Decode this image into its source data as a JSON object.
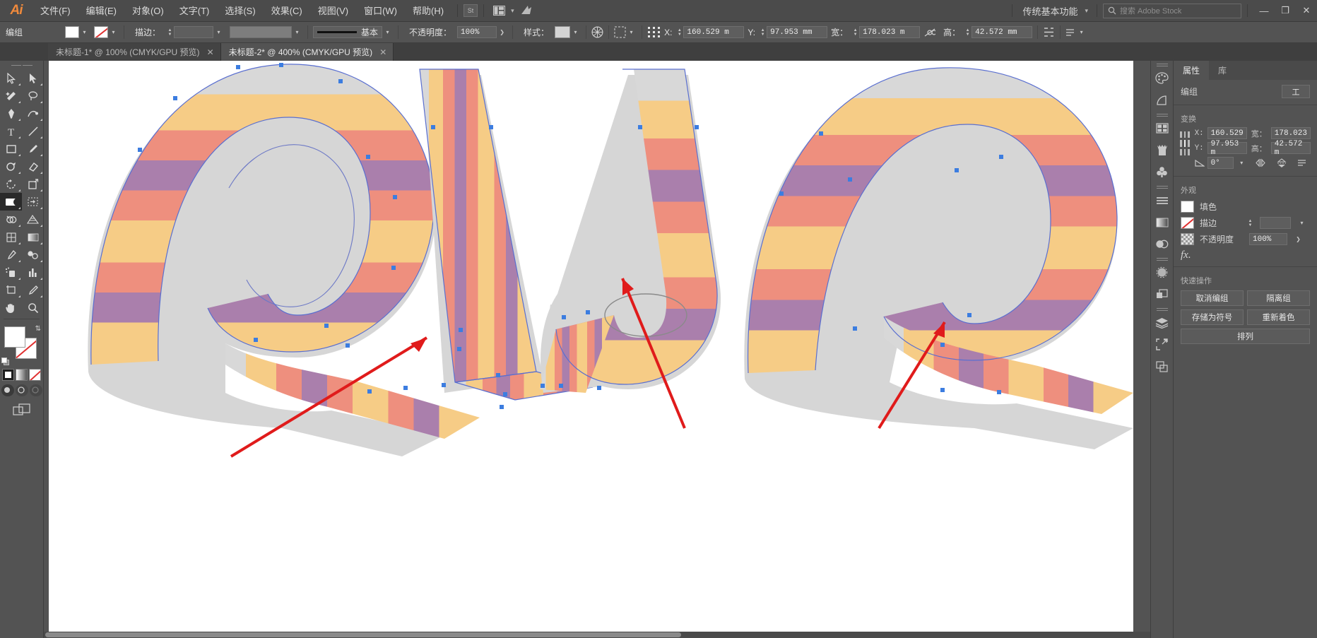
{
  "app": {
    "name": "Adobe Illustrator",
    "logo": "Ai"
  },
  "menubar": {
    "items": [
      {
        "label": "文件(F)",
        "name": "menu-file"
      },
      {
        "label": "编辑(E)",
        "name": "menu-edit"
      },
      {
        "label": "对象(O)",
        "name": "menu-object"
      },
      {
        "label": "文字(T)",
        "name": "menu-type"
      },
      {
        "label": "选择(S)",
        "name": "menu-select"
      },
      {
        "label": "效果(C)",
        "name": "menu-effect"
      },
      {
        "label": "视图(V)",
        "name": "menu-view"
      },
      {
        "label": "窗口(W)",
        "name": "menu-window"
      },
      {
        "label": "帮助(H)",
        "name": "menu-help"
      }
    ],
    "bridge_label": "St",
    "arrange_icon": "arrange-documents-icon",
    "stock_icon": "adobe-stock-icon",
    "workspace": "传统基本功能",
    "search_placeholder": "搜索 Adobe Stock",
    "minimize": "—",
    "restore": "❐",
    "close": "✕"
  },
  "controlbar": {
    "selection_label": "编组",
    "fill_label_icon": "fill-swatch",
    "stroke_label_icon": "stroke-swatch-none",
    "stroke_text": "描边：",
    "stroke_weight": "",
    "stroke_profile": "",
    "brush_name": "基本",
    "opacity_label": "不透明度：",
    "opacity_value": "100%",
    "style_label": "样式：",
    "recolor_icon": "recolor-artwork-icon",
    "align_icon": "align-icon",
    "transform_icon": "transform-reference-icon",
    "x_label": "X:",
    "x_value": "160.529 m",
    "y_label": "Y:",
    "y_value": "97.953 mm",
    "w_label": "宽：",
    "w_value": "178.023 m",
    "link_icon": "constrain-proportions-off-icon",
    "h_label": "高：",
    "h_value": "42.572 mm",
    "distribute_icon": "distribute-icon",
    "more_icon": "more-options-icon"
  },
  "tabs": [
    {
      "title": "未标题-1* @ 100% (CMYK/GPU 预览)",
      "active": false,
      "close": "✕",
      "name": "document-tab-1"
    },
    {
      "title": "未标题-2* @ 400% (CMYK/GPU 预览)",
      "active": true,
      "close": "✕",
      "name": "document-tab-2"
    }
  ],
  "toolbar": {
    "tools": [
      {
        "name": "selection-tool",
        "glyph": "▷"
      },
      {
        "name": "direct-selection-tool",
        "glyph": "▶"
      },
      {
        "name": "magic-wand-tool",
        "glyph": "✨"
      },
      {
        "name": "lasso-tool",
        "glyph": "◠"
      },
      {
        "name": "pen-tool",
        "glyph": "✒"
      },
      {
        "name": "curvature-tool",
        "glyph": "〜"
      },
      {
        "name": "type-tool",
        "glyph": "T"
      },
      {
        "name": "line-segment-tool",
        "glyph": "／"
      },
      {
        "name": "rectangle-tool",
        "glyph": "▢"
      },
      {
        "name": "paintbrush-tool",
        "glyph": "🖌"
      },
      {
        "name": "shaper-tool",
        "glyph": "◌"
      },
      {
        "name": "eraser-tool",
        "glyph": "◆"
      },
      {
        "name": "rotate-tool",
        "glyph": "↻"
      },
      {
        "name": "scale-tool",
        "glyph": "⬈"
      },
      {
        "name": "width-tool",
        "glyph": "⬓",
        "selected": true
      },
      {
        "name": "free-transform-tool",
        "glyph": "⬔"
      },
      {
        "name": "shape-builder-tool",
        "glyph": "◉"
      },
      {
        "name": "perspective-grid-tool",
        "glyph": "▤"
      },
      {
        "name": "mesh-tool",
        "glyph": "▦"
      },
      {
        "name": "gradient-tool",
        "glyph": "▭"
      },
      {
        "name": "eyedropper-tool",
        "glyph": "⚲"
      },
      {
        "name": "blend-tool",
        "glyph": "◐"
      },
      {
        "name": "symbol-sprayer-tool",
        "glyph": "❂"
      },
      {
        "name": "column-graph-tool",
        "glyph": "▥"
      },
      {
        "name": "artboard-tool",
        "glyph": "⊥"
      },
      {
        "name": "slice-tool",
        "glyph": "✂"
      },
      {
        "name": "hand-tool",
        "glyph": "✋"
      },
      {
        "name": "zoom-tool",
        "glyph": "🔍"
      }
    ],
    "fill_name": "fill-color-swatch",
    "stroke_name": "stroke-color-swatch-none",
    "swap_icon": "swap-fill-stroke-icon",
    "default_icon": "default-fill-stroke-icon",
    "modes": [
      {
        "name": "color-mode-button"
      },
      {
        "name": "gradient-mode-button"
      },
      {
        "name": "none-mode-button"
      }
    ],
    "screen_modes": [
      {
        "name": "drawing-mode-normal"
      },
      {
        "name": "drawing-mode-behind"
      },
      {
        "name": "drawing-mode-inside"
      }
    ],
    "screen_mode_icon": "change-screen-mode-icon"
  },
  "dock": {
    "icons": [
      {
        "name": "color-panel-icon"
      },
      {
        "name": "color-guide-panel-icon"
      },
      {
        "name": "swatches-panel-icon"
      },
      {
        "name": "brushes-panel-icon"
      },
      {
        "name": "symbols-panel-icon"
      },
      {
        "name": "stroke-panel-icon"
      },
      {
        "name": "gradient-panel-icon"
      },
      {
        "name": "transparency-panel-icon"
      },
      {
        "name": "appearance-panel-icon"
      },
      {
        "name": "graphic-styles-panel-icon"
      },
      {
        "name": "layers-panel-icon"
      },
      {
        "name": "artboards-panel-icon"
      },
      {
        "name": "asset-export-panel-icon"
      }
    ],
    "collapse_icon": "collapse-panels-icon"
  },
  "properties_panel": {
    "tabs": [
      {
        "label": "属性",
        "active": true,
        "name": "tab-properties"
      },
      {
        "label": "库",
        "active": false,
        "name": "tab-libraries"
      }
    ],
    "object_type": "编组",
    "object_action": "工",
    "transform": {
      "title": "变换",
      "x_label": "X:",
      "x_value": "160.529",
      "y_label": "Y:",
      "y_value": "97.953 m",
      "w_label": "宽：",
      "w_value": "178.023",
      "h_label": "高：",
      "h_value": "42.572 m",
      "angle_label": "angle-icon",
      "angle_value": "0°",
      "flip_h_icon": "flip-horizontal-icon",
      "flip_v_icon": "flip-vertical-icon",
      "more_icon": "transform-more-options-icon"
    },
    "appearance": {
      "title": "外观",
      "fill_label": "填色",
      "stroke_label": "描边",
      "stroke_weight": "",
      "opacity_label": "不透明度",
      "opacity_value": "100%",
      "fx_label": "fx."
    },
    "quick_actions": {
      "title": "快速操作",
      "buttons": [
        {
          "label": "取消编组",
          "name": "ungroup-button"
        },
        {
          "label": "隔离组",
          "name": "isolate-group-button"
        },
        {
          "label": "存储为符号",
          "name": "save-as-symbol-button"
        },
        {
          "label": "重新着色",
          "name": "recolor-button"
        },
        {
          "label": "排列",
          "name": "arrange-button"
        }
      ]
    }
  },
  "artwork": {
    "description": "描边艺术字母 Q L U Q 条纹丝带效果",
    "colors": {
      "yellow": "#F6CC86",
      "salmon": "#EE8F7E",
      "purple": "#AA7FAC",
      "shadow": "#D6D6D6",
      "path_stroke": "#4A63C8",
      "anchor": "#3C7DE0",
      "annotation": "#E01B1B"
    },
    "annotations": [
      {
        "name": "red-arrow-1"
      },
      {
        "name": "red-arrow-2"
      },
      {
        "name": "red-arrow-3"
      },
      {
        "name": "ellipse-highlight"
      }
    ]
  }
}
